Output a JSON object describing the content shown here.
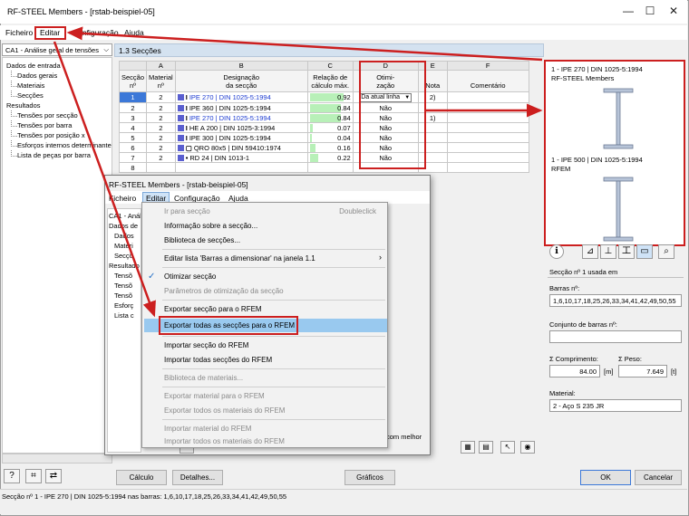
{
  "window": {
    "title": "RF-STEEL Members - [rstab-beispiel-05]",
    "minimize": "—",
    "maximize": "☐",
    "close": "✕"
  },
  "menubar": {
    "file": "Ficheiro",
    "edit": "Editar",
    "config": "Configuração",
    "help": "Ajuda"
  },
  "case_selector": "CA1 - Análise geral de tensões",
  "tree": {
    "input": "Dados de entrada",
    "items_input": [
      "Dados gerais",
      "Materiais",
      "Secções"
    ],
    "results": "Resultados",
    "items_results": [
      "Tensões por secção",
      "Tensões por barra",
      "Tensões por posição x",
      "Esforços internos determinantes",
      "Lista de peças por barra"
    ]
  },
  "panel_title": "1.3 Secções",
  "table": {
    "col_letters": [
      "A",
      "B",
      "C",
      "D",
      "E",
      "F"
    ],
    "headers": {
      "sec": [
        "Secção",
        "nº"
      ],
      "mat": [
        "Material",
        "nº"
      ],
      "des": [
        "Designação",
        "da secção"
      ],
      "ratio": [
        "Relação de",
        "cálculo máx."
      ],
      "opt": [
        "Otimi-",
        "zação"
      ],
      "note": [
        "Nota"
      ],
      "comment": [
        "Comentário"
      ]
    },
    "rows": [
      {
        "sec": "1",
        "mat": "2",
        "des": "IPE 270 | DIN 1025-5:1994",
        "ratio": "0.92",
        "opt": "Da atual linha",
        "note": "2)"
      },
      {
        "sec": "2",
        "mat": "2",
        "des": "IPE 360 | DIN 1025-5:1994",
        "ratio": "0.84",
        "opt": "Não",
        "note": ""
      },
      {
        "sec": "3",
        "mat": "2",
        "des": "IPE 270 | DIN 1025-5:1994",
        "ratio": "0.84",
        "opt": "Não",
        "note": "1)"
      },
      {
        "sec": "4",
        "mat": "2",
        "des": "HE A 200 | DIN 1025-3:1994",
        "ratio": "0.07",
        "opt": "Não",
        "note": ""
      },
      {
        "sec": "5",
        "mat": "2",
        "des": "IPE 300 | DIN 1025-5:1994",
        "ratio": "0.04",
        "opt": "Não",
        "note": ""
      },
      {
        "sec": "6",
        "mat": "2",
        "des": "QRO 80x5 | DIN 59410:1974",
        "ratio": "0.16",
        "opt": "Não",
        "note": ""
      },
      {
        "sec": "7",
        "mat": "2",
        "des": "RD 24 | DIN 1013-1",
        "ratio": "0.22",
        "opt": "Não",
        "note": ""
      },
      {
        "sec": "8",
        "mat": "",
        "des": "",
        "ratio": "",
        "opt": "",
        "note": ""
      }
    ]
  },
  "preview": {
    "top_title": "1 - IPE 270 | DIN 1025-5:1994",
    "top_sub": "RF-STEEL Members",
    "bottom_title": "1 - IPE 500 | DIN 1025-5:1994",
    "bottom_sub": "RFEM"
  },
  "info": {
    "title": "Secção nº 1 usada em",
    "members_label": "Barras nº:",
    "members_value": "1,6,10,17,18,25,26,33,34,41,42,49,50,55",
    "sets_label": "Conjunto de barras nº:",
    "sets_value": "",
    "length_label": "Σ Comprimento:",
    "length_value": "84.00",
    "length_unit": "[m]",
    "weight_label": "Σ Peso:",
    "weight_value": "7.649",
    "weight_unit": "[t]",
    "material_label": "Material:",
    "material_value": "2 - Aço S 235 JR"
  },
  "overlay": {
    "title": "RF-STEEL Members - [rstab-beispiel-05]",
    "menu": {
      "file": "Ficheiro",
      "edit": "Editar",
      "config": "Configuração",
      "help": "Ajuda"
    },
    "tree_head": "CA1 - Análise",
    "tree_items": [
      "Dados de",
      "Dados",
      "Materi",
      "Secçõ",
      "Resultado",
      "Tensõ",
      "Tensõ",
      "Tensõ",
      "Esforç",
      "Lista c"
    ],
    "side_note": "com melhor"
  },
  "edit_menu": {
    "goto": "Ir para secção",
    "goto_shortcut": "Doubleclick",
    "info": "Informação sobre a secção...",
    "library": "Biblioteca de secções...",
    "edit_list": "Editar lista 'Barras a dimensionar' na janela 1.1",
    "optimize": "Otimizar secção",
    "opt_params": "Parâmetros de otimização da secção",
    "export_one": "Exportar secção para o RFEM",
    "export_all": "Exportar todas as secções para o RFEM",
    "import_one": "Importar secção do RFEM",
    "import_all": "Importar todas secções do RFEM",
    "mat_library": "Biblioteca de materiais...",
    "export_mat": "Exportar material para o RFEM",
    "export_mats": "Exportar todos os materiais do RFEM",
    "import_mat": "Importar material do RFEM",
    "import_mats": "Importar todos os materiais do RFEM"
  },
  "buttons": {
    "calc": "Cálculo",
    "details": "Detalhes...",
    "graphics": "Gráficos",
    "ok": "OK",
    "cancel": "Cancelar"
  },
  "status": "Secção nº 1 - IPE 270 | DIN 1025-5:1994 nas barras: 1,6,10,17,18,25,26,33,34,41,42,49,50,55",
  "colors": {
    "highlight": "#cc1f1f",
    "selection": "#3c78d8",
    "menu_hover": "#99c9ef",
    "ratio_bar": "#b8f0b8"
  }
}
